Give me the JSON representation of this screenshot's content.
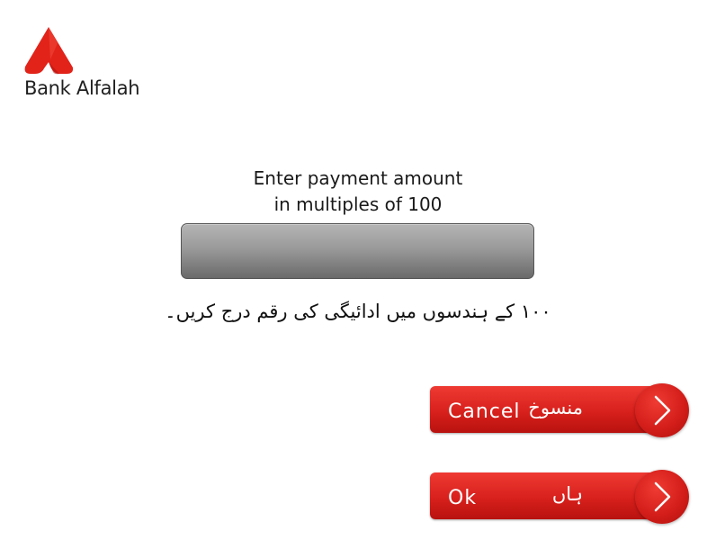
{
  "brand": {
    "name": "Bank Alfalah",
    "logo_icon": "bank-alfalah-logo-mark",
    "accent_color": "#e2231a"
  },
  "prompt": {
    "line1": "Enter payment amount",
    "line2": "in multiples of 100",
    "urdu": "۱۰۰ کے ہندسوں میں ادائیگی کی رقم درج کریں۔"
  },
  "amount_field": {
    "value": ""
  },
  "buttons": {
    "cancel": {
      "label": "Cancel",
      "urdu_label": "منسوخ",
      "icon": "chevron-right-icon"
    },
    "ok": {
      "label": "Ok",
      "urdu_label": "ہاں",
      "icon": "chevron-right-icon"
    }
  }
}
